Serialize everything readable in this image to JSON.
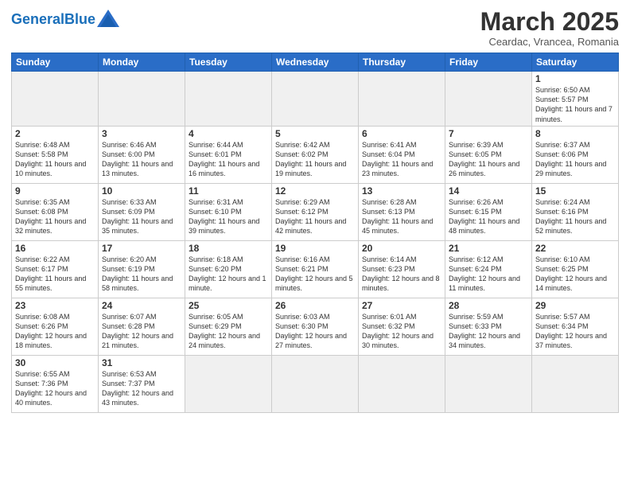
{
  "header": {
    "logo_general": "General",
    "logo_blue": "Blue",
    "month_title": "March 2025",
    "subtitle": "Ceardac, Vrancea, Romania"
  },
  "weekdays": [
    "Sunday",
    "Monday",
    "Tuesday",
    "Wednesday",
    "Thursday",
    "Friday",
    "Saturday"
  ],
  "weeks": [
    [
      {
        "day": "",
        "info": ""
      },
      {
        "day": "",
        "info": ""
      },
      {
        "day": "",
        "info": ""
      },
      {
        "day": "",
        "info": ""
      },
      {
        "day": "",
        "info": ""
      },
      {
        "day": "",
        "info": ""
      },
      {
        "day": "1",
        "info": "Sunrise: 6:50 AM\nSunset: 5:57 PM\nDaylight: 11 hours\nand 7 minutes."
      }
    ],
    [
      {
        "day": "2",
        "info": "Sunrise: 6:48 AM\nSunset: 5:58 PM\nDaylight: 11 hours\nand 10 minutes."
      },
      {
        "day": "3",
        "info": "Sunrise: 6:46 AM\nSunset: 6:00 PM\nDaylight: 11 hours\nand 13 minutes."
      },
      {
        "day": "4",
        "info": "Sunrise: 6:44 AM\nSunset: 6:01 PM\nDaylight: 11 hours\nand 16 minutes."
      },
      {
        "day": "5",
        "info": "Sunrise: 6:42 AM\nSunset: 6:02 PM\nDaylight: 11 hours\nand 19 minutes."
      },
      {
        "day": "6",
        "info": "Sunrise: 6:41 AM\nSunset: 6:04 PM\nDaylight: 11 hours\nand 23 minutes."
      },
      {
        "day": "7",
        "info": "Sunrise: 6:39 AM\nSunset: 6:05 PM\nDaylight: 11 hours\nand 26 minutes."
      },
      {
        "day": "8",
        "info": "Sunrise: 6:37 AM\nSunset: 6:06 PM\nDaylight: 11 hours\nand 29 minutes."
      }
    ],
    [
      {
        "day": "9",
        "info": "Sunrise: 6:35 AM\nSunset: 6:08 PM\nDaylight: 11 hours\nand 32 minutes."
      },
      {
        "day": "10",
        "info": "Sunrise: 6:33 AM\nSunset: 6:09 PM\nDaylight: 11 hours\nand 35 minutes."
      },
      {
        "day": "11",
        "info": "Sunrise: 6:31 AM\nSunset: 6:10 PM\nDaylight: 11 hours\nand 39 minutes."
      },
      {
        "day": "12",
        "info": "Sunrise: 6:29 AM\nSunset: 6:12 PM\nDaylight: 11 hours\nand 42 minutes."
      },
      {
        "day": "13",
        "info": "Sunrise: 6:28 AM\nSunset: 6:13 PM\nDaylight: 11 hours\nand 45 minutes."
      },
      {
        "day": "14",
        "info": "Sunrise: 6:26 AM\nSunset: 6:15 PM\nDaylight: 11 hours\nand 48 minutes."
      },
      {
        "day": "15",
        "info": "Sunrise: 6:24 AM\nSunset: 6:16 PM\nDaylight: 11 hours\nand 52 minutes."
      }
    ],
    [
      {
        "day": "16",
        "info": "Sunrise: 6:22 AM\nSunset: 6:17 PM\nDaylight: 11 hours\nand 55 minutes."
      },
      {
        "day": "17",
        "info": "Sunrise: 6:20 AM\nSunset: 6:19 PM\nDaylight: 11 hours\nand 58 minutes."
      },
      {
        "day": "18",
        "info": "Sunrise: 6:18 AM\nSunset: 6:20 PM\nDaylight: 12 hours\nand 1 minute."
      },
      {
        "day": "19",
        "info": "Sunrise: 6:16 AM\nSunset: 6:21 PM\nDaylight: 12 hours\nand 5 minutes."
      },
      {
        "day": "20",
        "info": "Sunrise: 6:14 AM\nSunset: 6:23 PM\nDaylight: 12 hours\nand 8 minutes."
      },
      {
        "day": "21",
        "info": "Sunrise: 6:12 AM\nSunset: 6:24 PM\nDaylight: 12 hours\nand 11 minutes."
      },
      {
        "day": "22",
        "info": "Sunrise: 6:10 AM\nSunset: 6:25 PM\nDaylight: 12 hours\nand 14 minutes."
      }
    ],
    [
      {
        "day": "23",
        "info": "Sunrise: 6:08 AM\nSunset: 6:26 PM\nDaylight: 12 hours\nand 18 minutes."
      },
      {
        "day": "24",
        "info": "Sunrise: 6:07 AM\nSunset: 6:28 PM\nDaylight: 12 hours\nand 21 minutes."
      },
      {
        "day": "25",
        "info": "Sunrise: 6:05 AM\nSunset: 6:29 PM\nDaylight: 12 hours\nand 24 minutes."
      },
      {
        "day": "26",
        "info": "Sunrise: 6:03 AM\nSunset: 6:30 PM\nDaylight: 12 hours\nand 27 minutes."
      },
      {
        "day": "27",
        "info": "Sunrise: 6:01 AM\nSunset: 6:32 PM\nDaylight: 12 hours\nand 30 minutes."
      },
      {
        "day": "28",
        "info": "Sunrise: 5:59 AM\nSunset: 6:33 PM\nDaylight: 12 hours\nand 34 minutes."
      },
      {
        "day": "29",
        "info": "Sunrise: 5:57 AM\nSunset: 6:34 PM\nDaylight: 12 hours\nand 37 minutes."
      }
    ],
    [
      {
        "day": "30",
        "info": "Sunrise: 6:55 AM\nSunset: 7:36 PM\nDaylight: 12 hours\nand 40 minutes."
      },
      {
        "day": "31",
        "info": "Sunrise: 6:53 AM\nSunset: 7:37 PM\nDaylight: 12 hours\nand 43 minutes."
      },
      {
        "day": "",
        "info": ""
      },
      {
        "day": "",
        "info": ""
      },
      {
        "day": "",
        "info": ""
      },
      {
        "day": "",
        "info": ""
      },
      {
        "day": "",
        "info": ""
      }
    ]
  ]
}
